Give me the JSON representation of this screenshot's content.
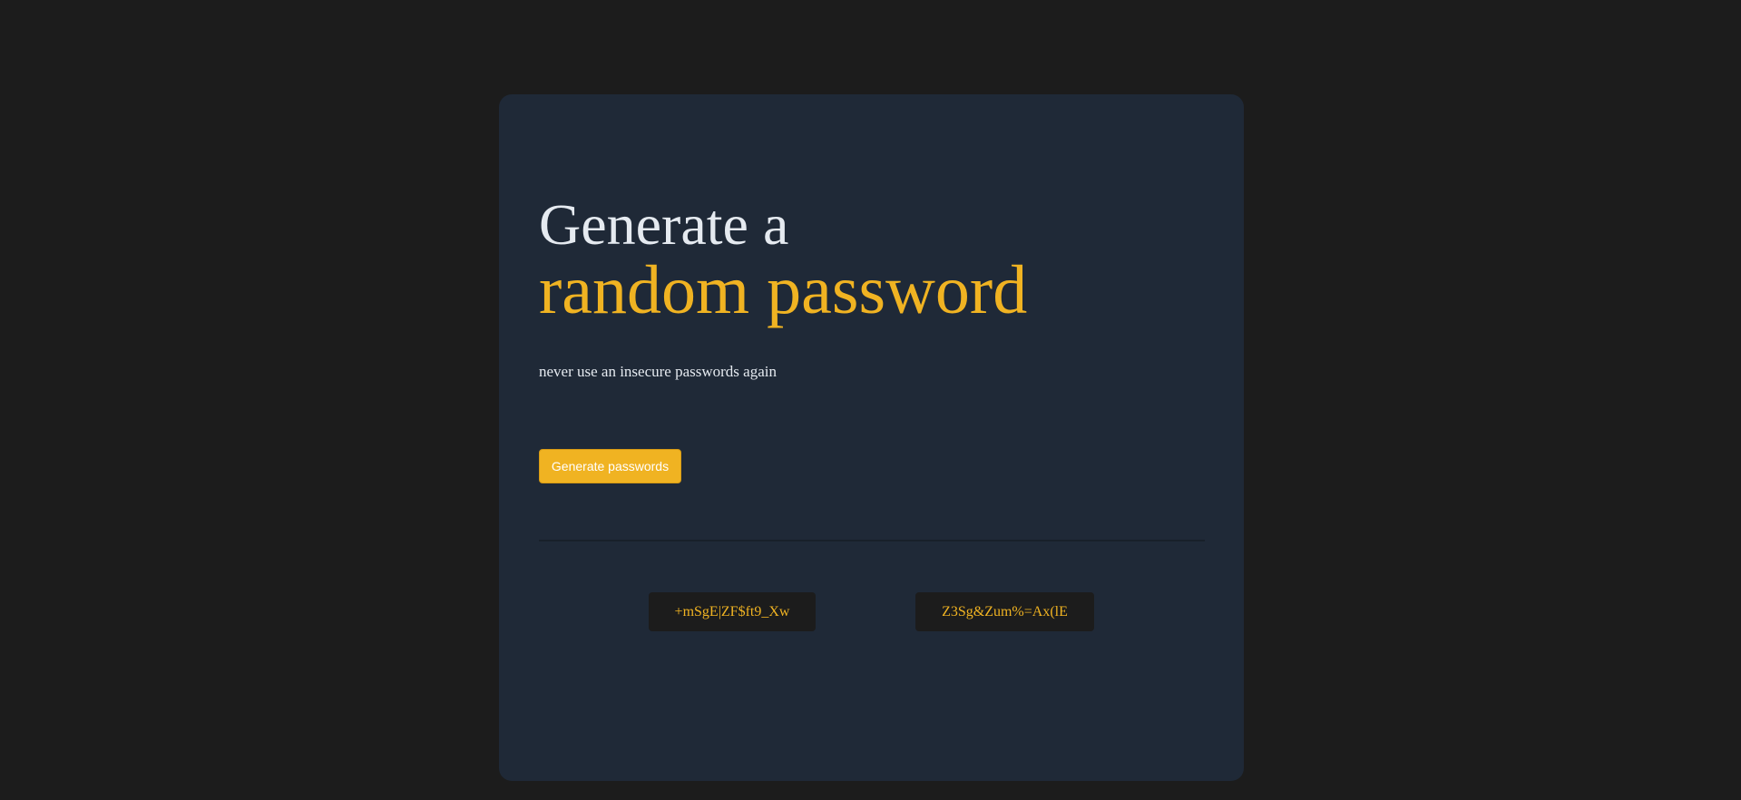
{
  "header": {
    "title_line1": "Generate a",
    "title_line2": "random password",
    "subtitle": "never use an insecure passwords again"
  },
  "actions": {
    "generate_label": "Generate passwords"
  },
  "passwords": [
    "+mSgE|ZF$ft9_Xw",
    "Z3Sg&Zum%=Ax(lE"
  ],
  "colors": {
    "page_background": "#1c1c1c",
    "card_background": "#1f2937",
    "accent": "#f0b322",
    "text": "#e5eaf0"
  }
}
